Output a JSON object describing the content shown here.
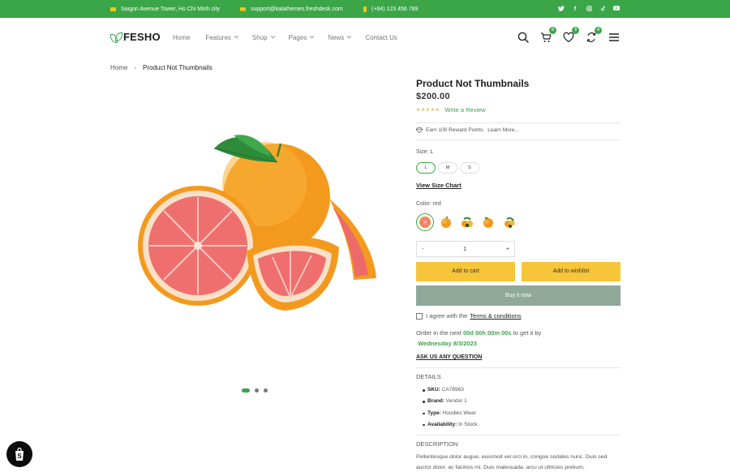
{
  "topbar": {
    "address": "Saigon Avenue Tower, Ho Chi Minh city",
    "email": "support@kalathemes.freshdesk.com",
    "phone": "(+84) 123 456 789",
    "social": [
      "twitter-icon",
      "facebook-icon",
      "instagram-icon",
      "tiktok-icon",
      "youtube-icon"
    ]
  },
  "header": {
    "logo": "FESHO",
    "nav": [
      "Home",
      "Features",
      "Shop",
      "Pages",
      "News",
      "Contact Us"
    ],
    "cart_count": "0",
    "wishlist_count": "3",
    "compare_count": "4"
  },
  "breadcrumb": {
    "home": "Home",
    "separator": "›",
    "current": "Product Not Thumbnails"
  },
  "product": {
    "title": "Product Not Thumbnails",
    "price": "$200.00",
    "stars": "★★★★★",
    "review_link": "Write a Review",
    "reward_text": "Earn 100 Reward Points.",
    "reward_more": "Learn More...",
    "size_label": "Size: L",
    "sizes": [
      "L",
      "M",
      "S"
    ],
    "size_chart": "View Size Chart",
    "color_label": "Color: red",
    "quantity": "1",
    "minus": "-",
    "plus": "+",
    "add_to_cart": "Add to cart",
    "add_to_wishlist": "Add to wishlist",
    "buy_now": "Buy it now",
    "agree_text": "I agree with the",
    "terms": "Terms & conditions",
    "order_prefix": "Order in the next",
    "order_time": "00d 00h 00m 00s",
    "order_suffix": "to get it by",
    "order_date": "Wednesday 8/3/2023",
    "ask": "ASK US ANY QUESTION",
    "details_label": "DETAILS",
    "details": [
      {
        "key": "SKU:",
        "value": "CA78963"
      },
      {
        "key": "Brand:",
        "value": "Vendor 1"
      },
      {
        "key": "Type:",
        "value": "Hoodies Wear"
      },
      {
        "key": "Availability:",
        "value": "In Stock"
      }
    ],
    "description_label": "DESCRIPTION",
    "description": "Pellentesque dolor augue, euismod vel orci in, congue sodales nunc. Duis sed auctor dolor, ac facilisis mi. Duis malesuada, arcu ut ultricies pretium,"
  },
  "colors": {
    "brand_green": "#3aa648",
    "button_yellow": "#f7c53a",
    "buy_now_gray": "#8fa89a"
  }
}
